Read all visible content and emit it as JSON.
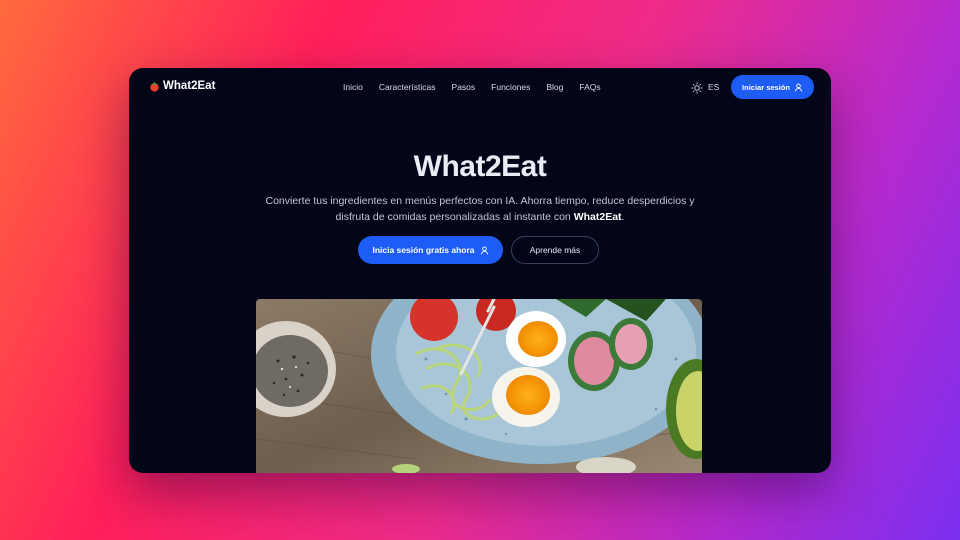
{
  "brand": {
    "name": "What2Eat",
    "logo_icon": "tomato-icon"
  },
  "nav": {
    "links": [
      "Inicio",
      "Características",
      "Pasos",
      "Funciones",
      "Blog",
      "FAQs"
    ],
    "theme_icon": "sun-icon",
    "language": "ES",
    "login_label": "Iniciar sesión",
    "login_icon": "user-icon"
  },
  "hero": {
    "title": "What2Eat",
    "subtitle_part1": "Convierte tus ingredientes en menús perfectos con IA. Ahorra tiempo, reduce desperdicios y disfruta de comidas personalizadas al instante con ",
    "subtitle_brand": "What2Eat",
    "subtitle_end": ".",
    "cta_primary": "Inicia sesión gratis ahora",
    "cta_secondary": "Aprende más"
  },
  "colors": {
    "accent": "#1d5cf5",
    "window_bg": "#020618",
    "background_gradient": [
      "#ff6a3d",
      "#ff1f5a",
      "#ef2b8a",
      "#b42ad0",
      "#7b2ff0"
    ]
  }
}
